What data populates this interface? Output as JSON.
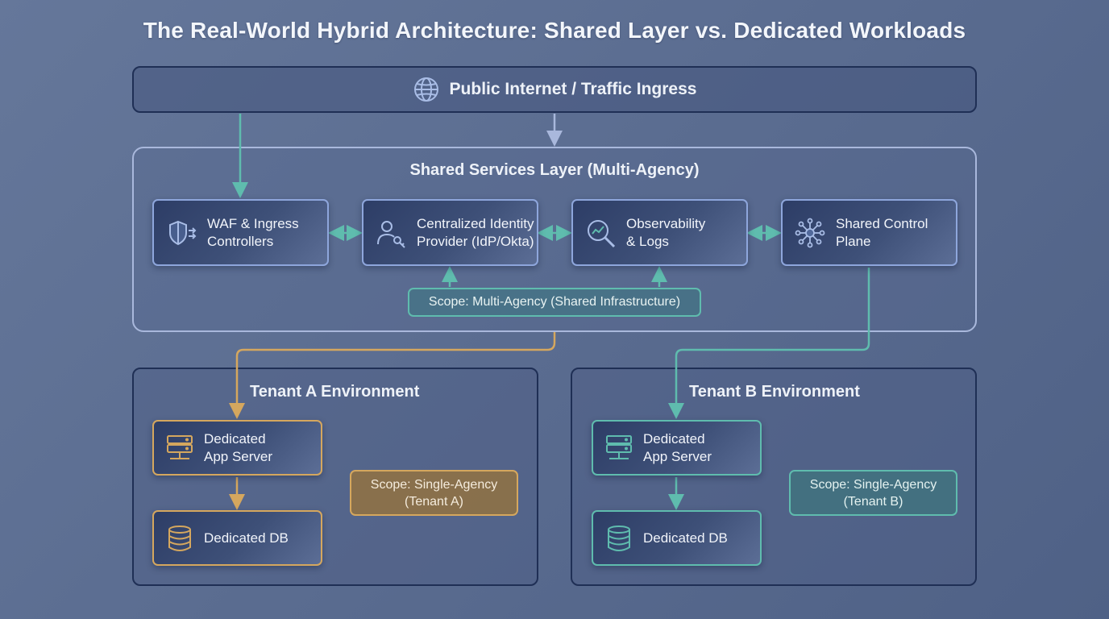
{
  "title": "The Real-World Hybrid Architecture: Shared Layer vs. Dedicated Workloads",
  "internet": {
    "label": "Public Internet / Traffic Ingress",
    "icon": "globe-icon"
  },
  "shared_layer": {
    "title": "Shared Services Layer (Multi-Agency)",
    "services": [
      {
        "label": "WAF & Ingress\nControllers",
        "icon": "shield-icon"
      },
      {
        "label": "Centralized Identity\nProvider (IdP/Okta)",
        "icon": "user-key-icon"
      },
      {
        "label": "Observability\n& Logs",
        "icon": "magnifier-chart-icon"
      },
      {
        "label": "Shared Control\nPlane",
        "icon": "network-hub-icon"
      }
    ],
    "scope": "Scope: Multi-Agency (Shared Infrastructure)"
  },
  "tenants": [
    {
      "title": "Tenant A Environment",
      "app_server": "Dedicated\nApp Server",
      "db": "Dedicated DB",
      "scope": "Scope: Single-Agency\n(Tenant A)",
      "accent": "#d5a75e"
    },
    {
      "title": "Tenant B Environment",
      "app_server": "Dedicated\nApp Server",
      "db": "Dedicated DB",
      "scope": "Scope: Single-Agency\n(Tenant B)",
      "accent": "#5fbcae"
    }
  ],
  "colors": {
    "teal": "#5fbcae",
    "gold": "#d5a75e",
    "blue_line": "#a9b8dc",
    "dark_border": "#1f2f55"
  }
}
